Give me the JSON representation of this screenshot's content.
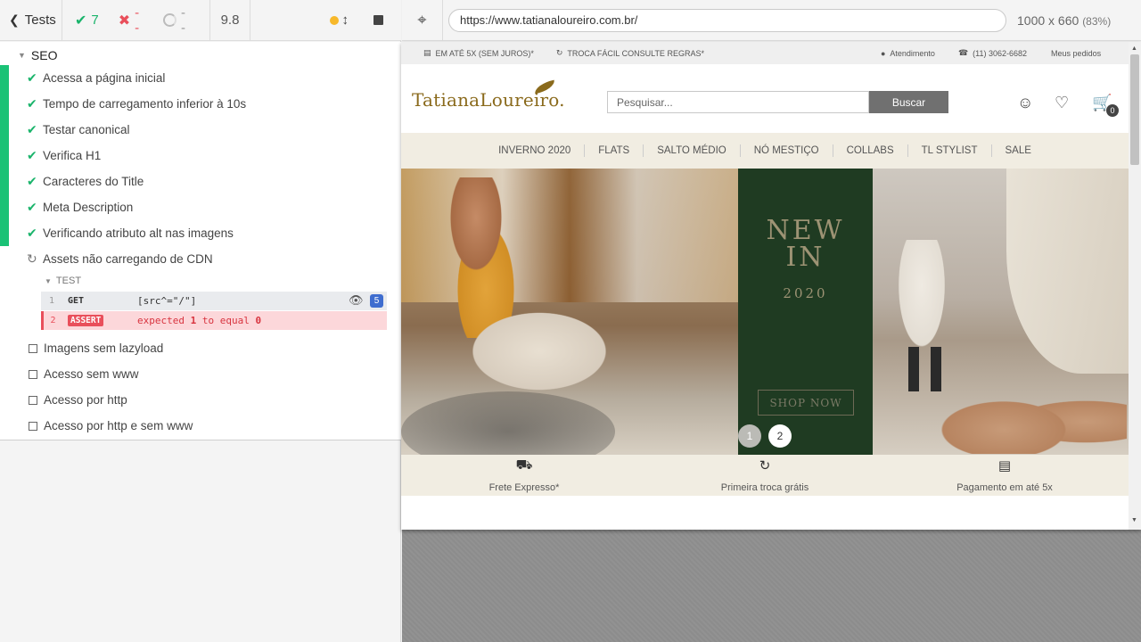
{
  "reporter": {
    "tests_label": "Tests",
    "passed": "7",
    "failed": "--",
    "pending": "--",
    "duration": "9.8"
  },
  "suite": {
    "title": "SEO",
    "passed_tests": [
      "Acessa a página inicial",
      "Tempo de carregamento inferior à 10s",
      "Testar canonical",
      "Verifica H1",
      "Caracteres do Title",
      "Meta Description",
      "Verificando atributo alt nas imagens"
    ],
    "running_test": "Assets não carregando de CDN",
    "pending_tests": [
      "Imagens sem lazyload",
      "Acesso sem www",
      "Acesso por http",
      "Acesso por http e sem www"
    ]
  },
  "command_log": {
    "section_label": "TEST",
    "commands": [
      {
        "num": "1",
        "name": "GET",
        "message": "[src^=\"/\"]",
        "count": "5"
      },
      {
        "num": "2",
        "name": "ASSERT",
        "message_pre": "expected ",
        "value1": "1",
        "message_mid": " to equal ",
        "value2": "0"
      }
    ]
  },
  "aut": {
    "url": "https://www.tatianaloureiro.com.br/",
    "viewport": "1000 x 660",
    "zoom": "(83%)"
  },
  "site": {
    "topbar": {
      "left1": "EM ATÉ 5X (SEM JUROS)*",
      "left2": "TROCA FÁCIL CONSULTE REGRAS*",
      "right1": "Atendimento",
      "right2": "(11) 3062-6682",
      "right3": "Meus pedidos"
    },
    "logo": "TatianaLoureiro.",
    "search_placeholder": "Pesquisar...",
    "search_button": "Buscar",
    "cart_count": "0",
    "nav": [
      "INVERNO 2020",
      "FLATS",
      "SALTO MÉDIO",
      "NÓ MESTIÇO",
      "COLLABS",
      "TL STYLIST",
      "SALE"
    ],
    "banner": {
      "headline_line1": "NEW",
      "headline_line2": "IN",
      "year": "2020",
      "cta": "SHOP NOW",
      "pager": [
        "1",
        "2"
      ]
    },
    "benefits": [
      "Frete Expresso*",
      "Primeira troca grátis",
      "Pagamento em até 5x"
    ]
  },
  "colors": {
    "pass": "#1ab46b",
    "fail": "#e94f5b",
    "promo_bg": "#1f3b22",
    "nav_bg": "#f1ede2",
    "logo": "#8a6a1c"
  }
}
